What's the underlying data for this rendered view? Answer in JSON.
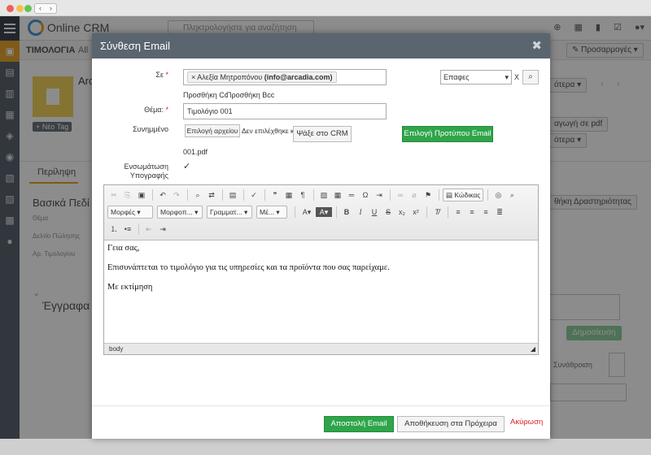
{
  "app": {
    "name": "Online CRM",
    "search_placeholder": "Πληκτρολογήστε για αναζήτηση",
    "breadcrumb": "ΤΙΜΟΛΟΓΙΑ",
    "breadcrumb_all": "All",
    "preferences": "Προσαρμογές",
    "new_tag": "+ Νέο Tag",
    "record_title": "Arc",
    "more": "ότερα",
    "export_pdf": "αγωγή σε pdf",
    "more2": "ότερα",
    "tab_overview": "Περίληψη",
    "section_basic": "Βασικά Πεδί",
    "field_subject": "Θέμα",
    "field_sales_date": "Δελτίο Πώλησης",
    "field_invoice_no": "Αρ. Τιμολογίου",
    "section_documents": "Έγγραφα",
    "add_activity": "θήκη Δραστηριότητας",
    "publish": "Δημοσίευση",
    "aggregation": "Συνάθροιση"
  },
  "modal": {
    "title": "Σύνθεση Email",
    "to_label": "Σε",
    "required_mark": "*",
    "recipient_name": "Αλεξία Μητροπόνου",
    "recipient_email": "(info@arcadia.com)",
    "add_cc": "Προσθήκη Cc",
    "add_bcc": "Προσθήκη Bcc",
    "contacts_select": "Επαφες",
    "clear": "X",
    "subject_label": "Θέμα:",
    "subject_value": "Τιμολόγιο 001",
    "attachment_label": "Συνημμένο",
    "choose_file": "Επιλογή αρχείου",
    "no_file": "Δεν επιλέχθηκε κα",
    "search_crm": "Ψάξε στο CRM",
    "choose_template": "Επιλογή Προτύπου Email",
    "attachment_file": "001.pdf",
    "signature_label": "Ενσωμάτωση Υπογραφής",
    "signature_checked": "✓",
    "toolbar": {
      "styles": "Μορφές",
      "format": "Μορφοπ...",
      "font": "Γραμματ...",
      "size": "Μέ...",
      "source": "Κώδικας"
    },
    "body_lines": [
      "Γεια σας,",
      "Επισυνάπτεται το τιμολόγιο για τις υπηρεσίες και τα προϊόντα που σας παρείχαμε.",
      "Με εκτίμηση"
    ],
    "status_path": "body",
    "send": "Αποστολή Email",
    "save_draft": "Αποθήκευση στα Πρόχειρα",
    "cancel": "Ακύρωση"
  },
  "colors": {
    "primary_green": "#2fa54a",
    "header_slate": "#5a6570",
    "sidebar": "#5c6370",
    "accent_orange": "#e7a52f",
    "cancel_red": "#d9232e"
  }
}
